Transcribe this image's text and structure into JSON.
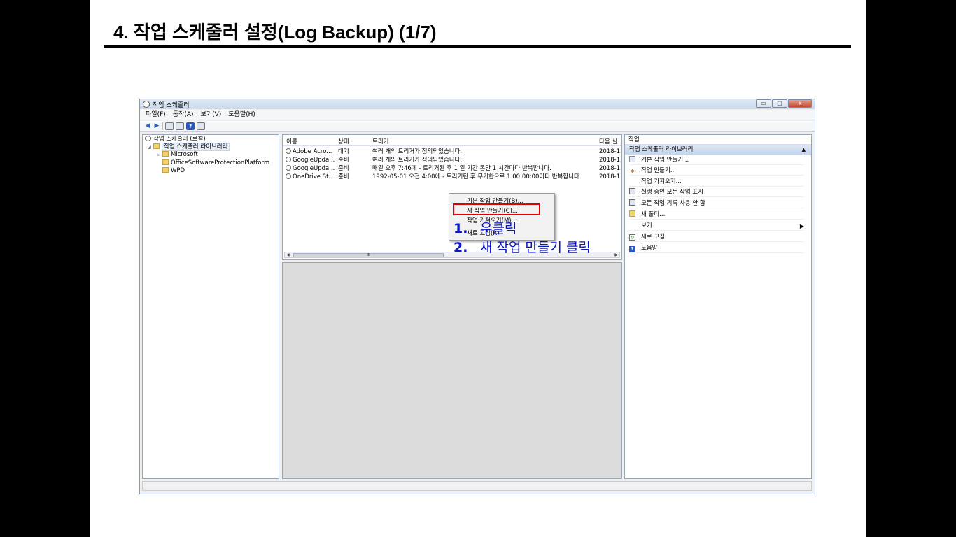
{
  "slide_title": "4. 작업 스케줄러 설정(Log Backup) (1/7)",
  "window": {
    "title": "작업 스케줄러",
    "controls": [
      "▭",
      "▢",
      "x"
    ]
  },
  "menu": [
    "파일(F)",
    "동작(A)",
    "보기(V)",
    "도움말(H)"
  ],
  "tree": {
    "root": "작업 스케줄러 (로컬)",
    "library": "작업 스케줄러 라이브러리",
    "children": [
      "Microsoft",
      "OfficeSoftwareProtectionPlatform",
      "WPD"
    ]
  },
  "task_list": {
    "columns": [
      "이름",
      "상태",
      "트리거",
      "다음 실"
    ],
    "rows": [
      {
        "name": "Adobe Acro...",
        "status": "대기",
        "trigger": "여러 개의 트리거가 정의되었습니다.",
        "next": "2018-1"
      },
      {
        "name": "GoogleUpda...",
        "status": "준비",
        "trigger": "여러 개의 트리거가 정의되었습니다.",
        "next": "2018-1"
      },
      {
        "name": "GoogleUpda...",
        "status": "준비",
        "trigger": "매일 오후 7:46에 - 트리거된 후 1 일 기간 동안 1 시간마다 반복합니다.",
        "next": "2018-1"
      },
      {
        "name": "OneDrive St...",
        "status": "준비",
        "trigger": "1992-05-01 오전 4:00에 - 트리거된 후 무기한으로 1.00:00:00마다 반복합니다.",
        "next": "2018-1"
      }
    ],
    "scroll_thumb": "III"
  },
  "context_menu": [
    "기본 작업 만들기(B)...",
    "새 작업 만들기(C)...",
    "작업 가져오기(M)...",
    "새로 고침(R)"
  ],
  "actions": {
    "header": "작업",
    "section": "작업 스케줄러 라이브러리",
    "items": [
      "기본 작업 만들기...",
      "작업 만들기...",
      "작업 가져오기...",
      "실행 중인 모든 작업 표시",
      "모든 작업 기록 사용 안 함",
      "새 폴더...",
      "보기",
      "새로 고침",
      "도움말"
    ]
  },
  "annotations": [
    {
      "num": "1.",
      "text": "우클릭"
    },
    {
      "num": "2.",
      "text": "새 작업 만들기 클릭"
    }
  ]
}
